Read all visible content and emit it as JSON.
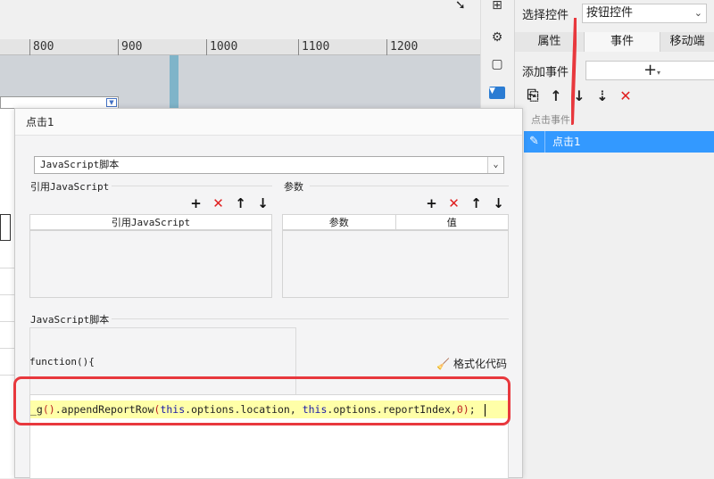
{
  "ruler": {
    "ticks": [
      "800",
      "900",
      "1000",
      "1100",
      "1200"
    ]
  },
  "right_panel": {
    "select_control_label": "选择控件",
    "select_control_value": "按钮控件",
    "tabs": [
      "属性",
      "事件",
      "移动端"
    ],
    "add_event_label": "添加事件",
    "add_event_symbol": "+",
    "event_category": "点击事件",
    "event_item": "点击1"
  },
  "dialog": {
    "title": "点击1",
    "type_select": "JavaScript脚本",
    "ref_js_group": "引用JavaScript",
    "ref_js_column": "引用JavaScript",
    "params_group": "参数",
    "params_columns": [
      "参数",
      "值"
    ],
    "script_group": "JavaScript脚本",
    "function_signature": "function(){",
    "format_button": "格式化代码",
    "code": {
      "prefix": "_g",
      "call": ".appendReportRow",
      "this1": "this",
      "arg1": ".options.location, ",
      "this2": "this",
      "arg2": ".options.reportIndex,",
      "num": "0",
      "suffix": ";"
    }
  },
  "colors": {
    "accent": "#3399ff",
    "annotation": "#e8383d",
    "highlight": "#ffffa8"
  }
}
